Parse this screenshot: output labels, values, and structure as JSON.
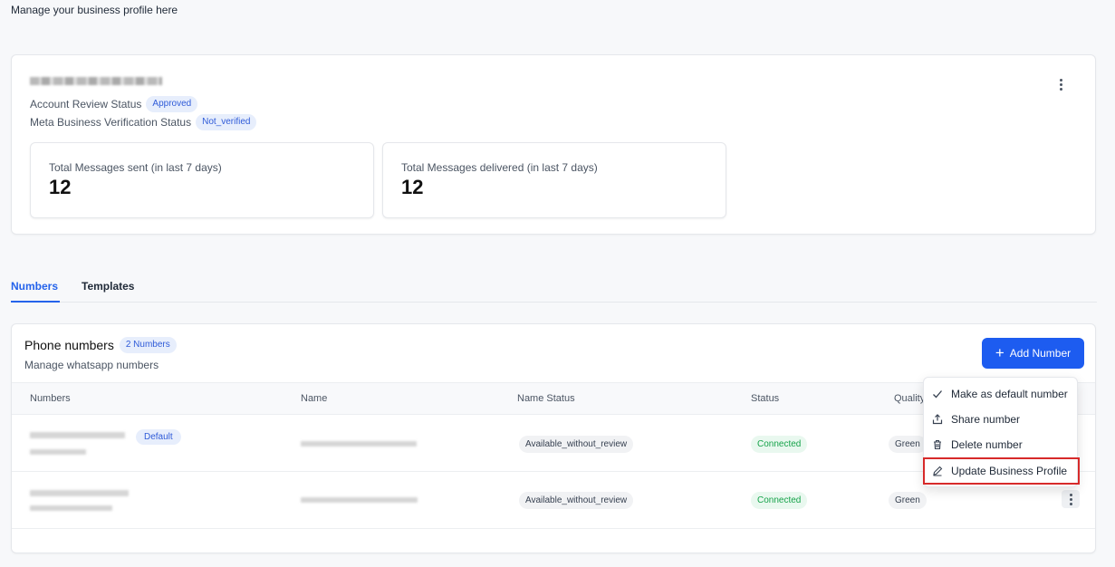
{
  "page": {
    "subtitle": "Manage your business profile here"
  },
  "profile": {
    "account_review_label": "Account Review Status",
    "account_review_value": "Approved",
    "meta_verification_label": "Meta Business Verification Status",
    "meta_verification_value": "Not_verified",
    "stats": [
      {
        "label": "Total Messages sent (in last 7 days)",
        "value": "12"
      },
      {
        "label": "Total Messages delivered (in last 7 days)",
        "value": "12"
      }
    ]
  },
  "tabs": [
    {
      "label": "Numbers",
      "active": true
    },
    {
      "label": "Templates",
      "active": false
    }
  ],
  "numbers_section": {
    "title": "Phone numbers",
    "count_badge": "2 Numbers",
    "subtitle": "Manage whatsapp numbers",
    "add_button": "Add Number",
    "columns": [
      "Numbers",
      "Name",
      "Name Status",
      "Status",
      "Quality"
    ],
    "rows": [
      {
        "default_badge": "Default",
        "name_status": "Available_without_review",
        "status": "Connected",
        "quality": "Green"
      },
      {
        "default_badge": "",
        "name_status": "Available_without_review",
        "status": "Connected",
        "quality": "Green"
      }
    ]
  },
  "context_menu": {
    "items": [
      {
        "label": "Make as default number",
        "icon": "check-icon"
      },
      {
        "label": "Share number",
        "icon": "share-icon"
      },
      {
        "label": "Delete number",
        "icon": "trash-icon"
      },
      {
        "label": "Update Business Profile",
        "icon": "pencil-icon"
      }
    ]
  },
  "colors": {
    "accent": "#1d5cf0",
    "connected": "#16a34a",
    "highlight": "#d72a2a"
  }
}
